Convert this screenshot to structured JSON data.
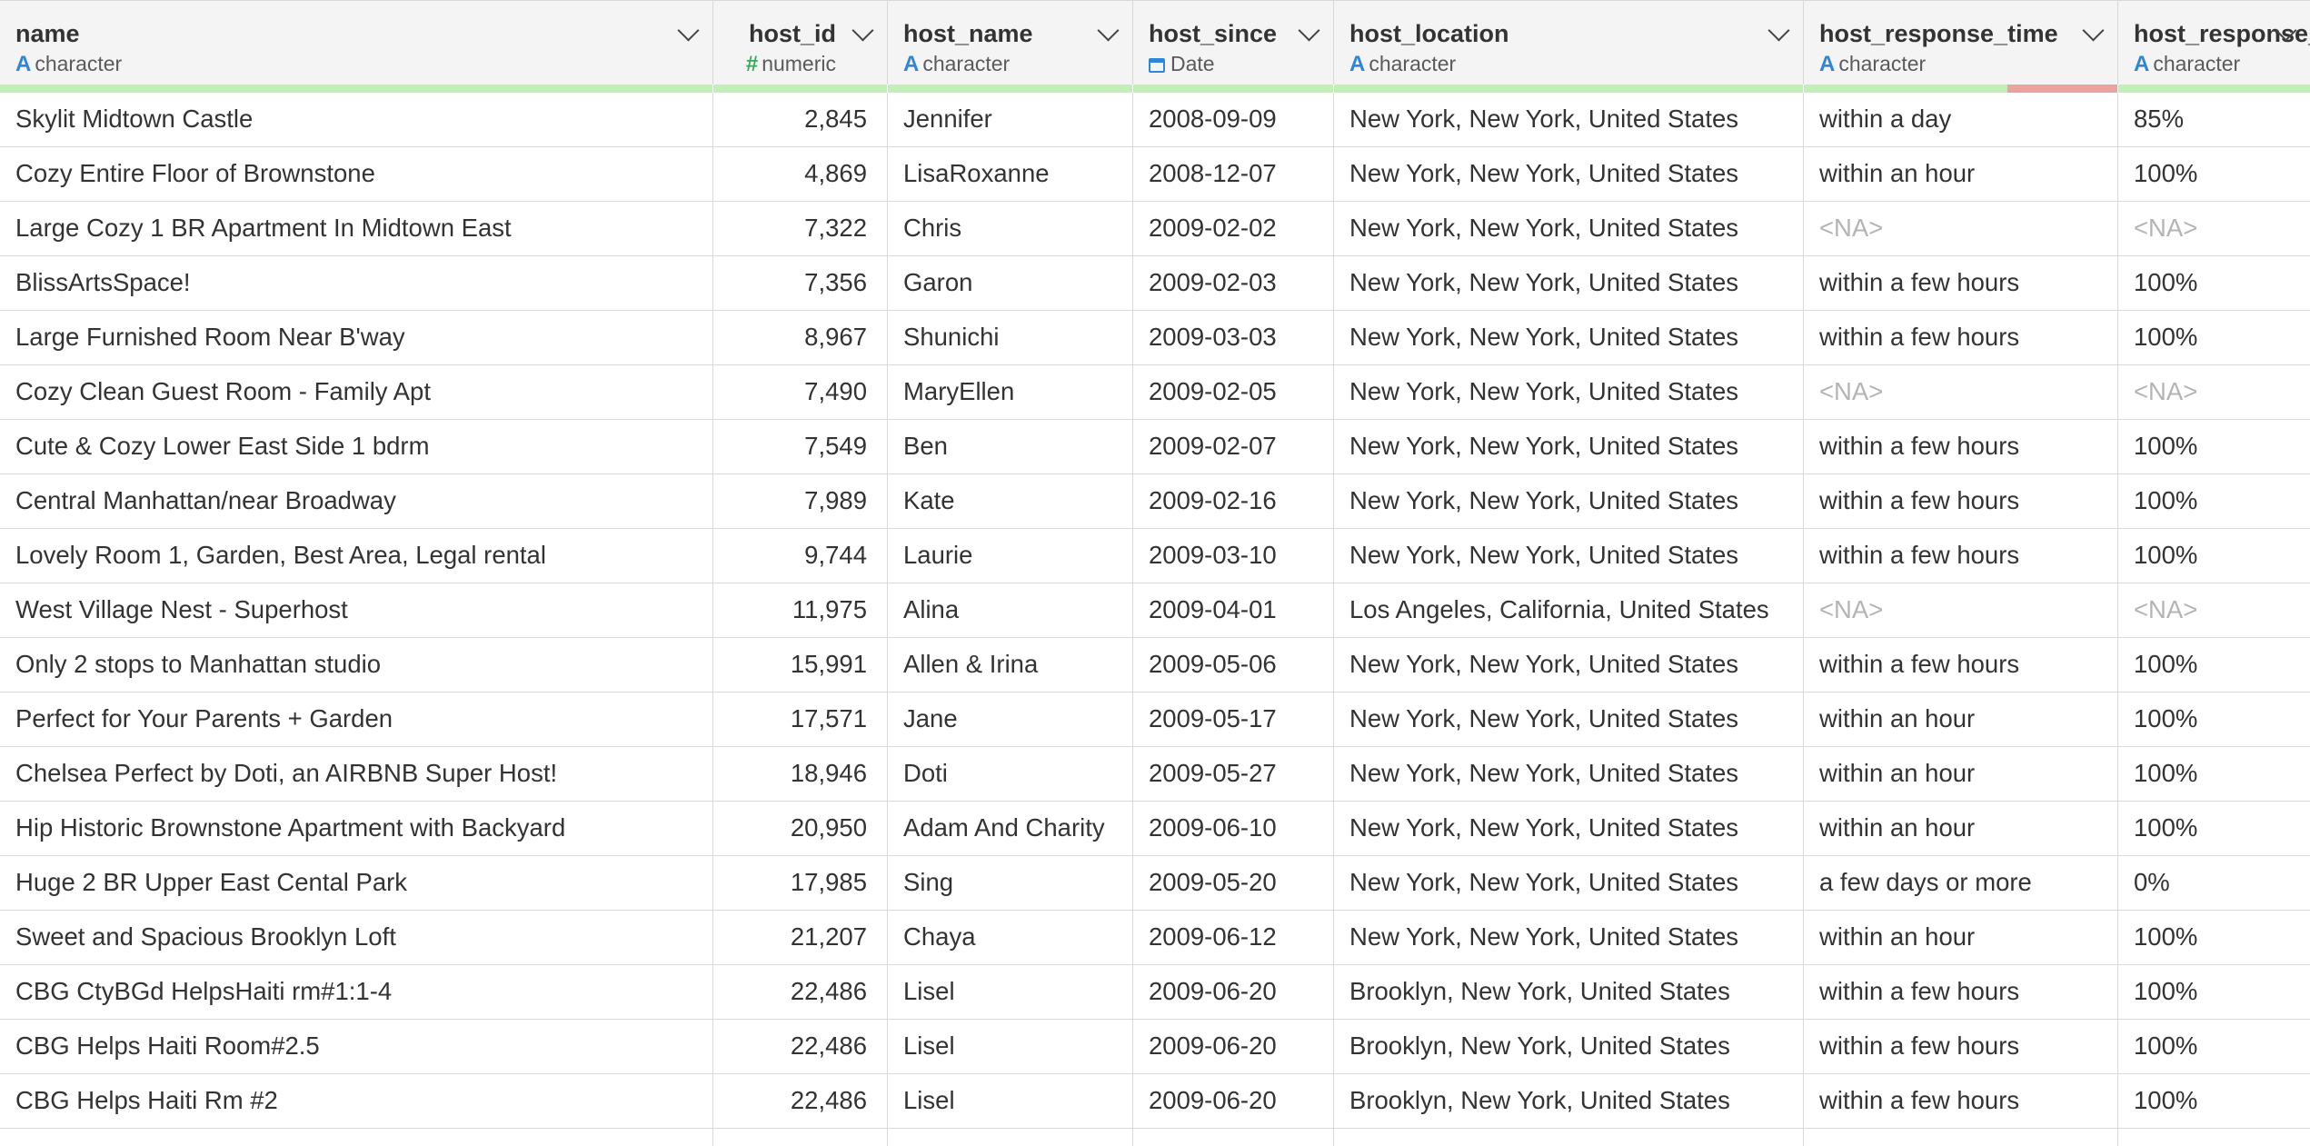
{
  "columns": [
    {
      "name": "name",
      "type": "character",
      "type_icon": "text-type-icon",
      "align": "left"
    },
    {
      "name": "host_id",
      "type": "numeric",
      "type_icon": "number-type-icon",
      "align": "right"
    },
    {
      "name": "host_name",
      "type": "character",
      "type_icon": "text-type-icon",
      "align": "left"
    },
    {
      "name": "host_since",
      "type": "Date",
      "type_icon": "calendar-icon",
      "align": "left"
    },
    {
      "name": "host_location",
      "type": "character",
      "type_icon": "text-type-icon",
      "align": "left"
    },
    {
      "name": "host_response_time",
      "type": "character",
      "type_icon": "text-type-icon",
      "align": "left"
    },
    {
      "name": "host_response_rate",
      "type": "character",
      "type_icon": "text-type-icon",
      "align": "left"
    }
  ],
  "quality_bar": {
    "valid_color": "#c2efb6",
    "missing_color": "#eaa39e",
    "missing_fraction": [
      0,
      0,
      0,
      0,
      0,
      0.35,
      0
    ]
  },
  "rows": [
    [
      "Skylit Midtown Castle",
      "2,845",
      "Jennifer",
      "2008-09-09",
      "New York, New York, United States",
      "within a day",
      "85%"
    ],
    [
      "Cozy Entire Floor of Brownstone",
      "4,869",
      "LisaRoxanne",
      "2008-12-07",
      "New York, New York, United States",
      "within an hour",
      "100%"
    ],
    [
      "Large Cozy 1 BR Apartment In Midtown East",
      "7,322",
      "Chris",
      "2009-02-02",
      "New York, New York, United States",
      "<NA>",
      "<NA>"
    ],
    [
      "BlissArtsSpace!",
      "7,356",
      "Garon",
      "2009-02-03",
      "New York, New York, United States",
      "within a few hours",
      "100%"
    ],
    [
      "Large Furnished Room Near B'way",
      "8,967",
      "Shunichi",
      "2009-03-03",
      "New York, New York, United States",
      "within a few hours",
      "100%"
    ],
    [
      "Cozy Clean Guest Room - Family Apt",
      "7,490",
      "MaryEllen",
      "2009-02-05",
      "New York, New York, United States",
      "<NA>",
      "<NA>"
    ],
    [
      "Cute & Cozy Lower East Side 1 bdrm",
      "7,549",
      "Ben",
      "2009-02-07",
      "New York, New York, United States",
      "within a few hours",
      "100%"
    ],
    [
      "Central Manhattan/near Broadway",
      "7,989",
      "Kate",
      "2009-02-16",
      "New York, New York, United States",
      "within a few hours",
      "100%"
    ],
    [
      "Lovely Room 1, Garden, Best Area, Legal rental",
      "9,744",
      "Laurie",
      "2009-03-10",
      "New York, New York, United States",
      "within a few hours",
      "100%"
    ],
    [
      "West Village Nest - Superhost",
      "11,975",
      "Alina",
      "2009-04-01",
      "Los Angeles, California, United States",
      "<NA>",
      "<NA>"
    ],
    [
      "Only 2 stops to Manhattan studio",
      "15,991",
      "Allen & Irina",
      "2009-05-06",
      "New York, New York, United States",
      "within a few hours",
      "100%"
    ],
    [
      "Perfect for Your Parents + Garden",
      "17,571",
      "Jane",
      "2009-05-17",
      "New York, New York, United States",
      "within an hour",
      "100%"
    ],
    [
      "Chelsea Perfect  by Doti, an AIRBNB  Super Host!",
      "18,946",
      "Doti",
      "2009-05-27",
      "New York, New York, United States",
      "within an hour",
      "100%"
    ],
    [
      "Hip Historic Brownstone Apartment with Backyard",
      "20,950",
      "Adam And Charity",
      "2009-06-10",
      "New York, New York, United States",
      "within an hour",
      "100%"
    ],
    [
      "Huge 2 BR Upper East  Cental Park",
      "17,985",
      "Sing",
      "2009-05-20",
      "New York, New York, United States",
      "a few days or more",
      "0%"
    ],
    [
      "Sweet and Spacious Brooklyn Loft",
      "21,207",
      "Chaya",
      "2009-06-12",
      "New York, New York, United States",
      "within an hour",
      "100%"
    ],
    [
      "CBG CtyBGd HelpsHaiti rm#1:1-4",
      "22,486",
      "Lisel",
      "2009-06-20",
      "Brooklyn, New York, United States",
      "within a few hours",
      "100%"
    ],
    [
      "CBG Helps Haiti Room#2.5",
      "22,486",
      "Lisel",
      "2009-06-20",
      "Brooklyn, New York, United States",
      "within a few hours",
      "100%"
    ],
    [
      "CBG Helps Haiti Rm #2",
      "22,486",
      "Lisel",
      "2009-06-20",
      "Brooklyn, New York, United States",
      "within a few hours",
      "100%"
    ]
  ],
  "na_text": "<NA>"
}
